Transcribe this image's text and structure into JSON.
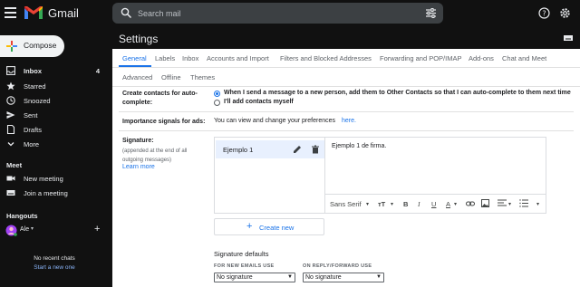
{
  "app": {
    "name": "Gmail"
  },
  "search": {
    "placeholder": "Search mail"
  },
  "sidebar": {
    "compose_label": "Compose",
    "items": [
      {
        "label": "Inbox",
        "count": "4",
        "bold": true
      },
      {
        "label": "Starred",
        "count": ""
      },
      {
        "label": "Snoozed",
        "count": ""
      },
      {
        "label": "Sent",
        "count": ""
      },
      {
        "label": "Drafts",
        "count": ""
      },
      {
        "label": "More",
        "count": ""
      }
    ],
    "meet": {
      "title": "Meet",
      "new_meeting": "New meeting",
      "join_meeting": "Join a meeting"
    },
    "hangouts": {
      "title": "Hangouts",
      "user": "Ale",
      "no_chats": "No recent chats",
      "start_new": "Start a new one"
    }
  },
  "settings": {
    "title": "Settings",
    "tabs_row1": [
      "General",
      "Labels",
      "Inbox",
      "Accounts and Import",
      "Filters and Blocked Addresses",
      "Forwarding and POP/IMAP",
      "Add-ons",
      "Chat and Meet"
    ],
    "tabs_row2": [
      "Advanced",
      "Offline",
      "Themes"
    ],
    "active_tab": "General",
    "create_contacts": {
      "label": "Create contacts for auto-complete:",
      "option1": "When I send a message to a new person, add them to Other Contacts so that I can auto-complete to them next time",
      "option2": "I'll add contacts myself",
      "selected": 1
    },
    "importance": {
      "label": "Importance signals for ads:",
      "text": "You can view and change your preferences",
      "link": "here."
    },
    "signature": {
      "label": "Signature:",
      "sub": "(appended at the end of all outgoing messages)",
      "learn_more": "Learn more",
      "items": [
        {
          "name": "Ejemplo 1"
        }
      ],
      "editor_text": "Ejemplo 1 de firma.",
      "font": "Sans Serif",
      "create_new": "Create new"
    },
    "defaults": {
      "title": "Signature defaults",
      "new_label": "FOR NEW EMAILS USE",
      "reply_label": "ON REPLY/FORWARD USE",
      "new_value": "No signature",
      "reply_value": "No signature"
    }
  },
  "colors": {
    "accent": "#1a73e8",
    "dark_bg": "#111111",
    "link": "#1a73e8"
  }
}
